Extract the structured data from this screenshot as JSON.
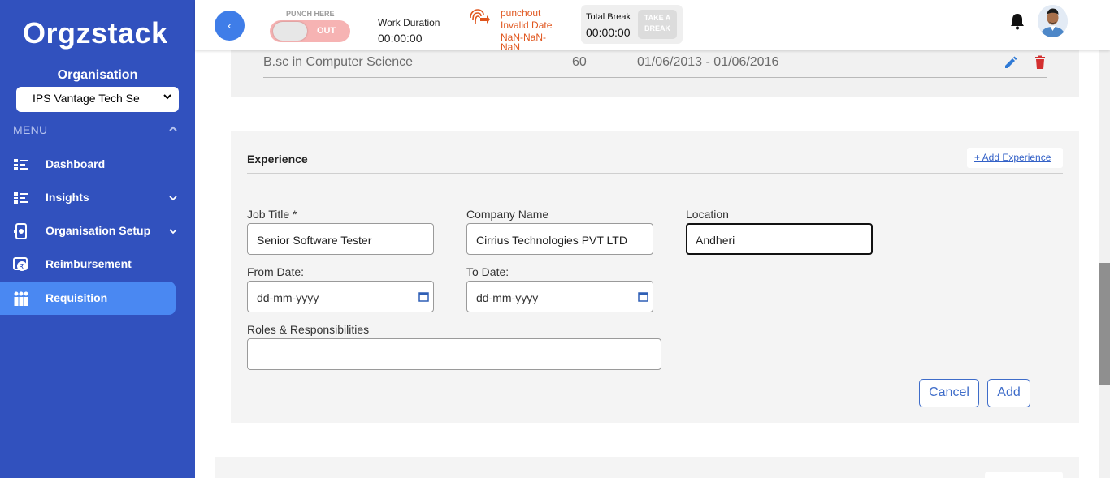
{
  "brand": {
    "logo_text": "Orgzstack"
  },
  "sidebar": {
    "org_label": "Organisation",
    "org_selected": "IPS Vantage Tech Se",
    "menu_heading": "MENU",
    "items": [
      {
        "label": "Dashboard",
        "icon": "dashboard-icon",
        "active": false,
        "has_caret": false
      },
      {
        "label": "Insights",
        "icon": "insights-icon",
        "active": false,
        "has_caret": true
      },
      {
        "label": "Organisation Setup",
        "icon": "organisation-setup-icon",
        "active": false,
        "has_caret": true
      },
      {
        "label": "Reimbursement",
        "icon": "reimbursement-icon",
        "active": false,
        "has_caret": false
      },
      {
        "label": "Requisition",
        "icon": "requisition-icon",
        "active": true,
        "has_caret": false
      }
    ]
  },
  "topbar": {
    "back_glyph": "‹",
    "punch_label": "PUNCH HERE",
    "punch_state": "OUT",
    "work_duration_label": "Work Duration",
    "work_duration_value": "00:00:00",
    "punch_status_line1": "punchout",
    "punch_status_line2": "Invalid Date",
    "punch_status_line3": "NaN-NaN-",
    "punch_status_line4": "NaN",
    "total_break_label": "Total Break",
    "total_break_value": "00:00:00",
    "take_break_line1": "TAKE A",
    "take_break_line2": "BREAK"
  },
  "education": {
    "degree": "B.sc in Computer Science",
    "score": "60",
    "dates": "01/06/2013 - 01/06/2016"
  },
  "experience": {
    "title": "Experience",
    "add_link": "+ Add Experience",
    "job_title_label": "Job Title *",
    "job_title_value": "Senior Software Tester",
    "company_label": "Company Name",
    "company_value": "Cirrius Technologies PVT LTD",
    "location_label": "Location",
    "location_value": "Andheri",
    "from_date_label": "From Date:",
    "from_date_value": "dd-mm-yyyy",
    "to_date_label": "To Date:",
    "to_date_value": "dd-mm-yyyy",
    "roles_label": "Roles & Responsibilities",
    "roles_value": "",
    "cancel_label": "Cancel",
    "add_label": "Add"
  },
  "colors": {
    "sidebar_bg": "#3151be",
    "active_item": "#4a88f2",
    "accent": "#3e6cc9",
    "punch_status": "#e0561e",
    "delete": "#d32f2f"
  }
}
